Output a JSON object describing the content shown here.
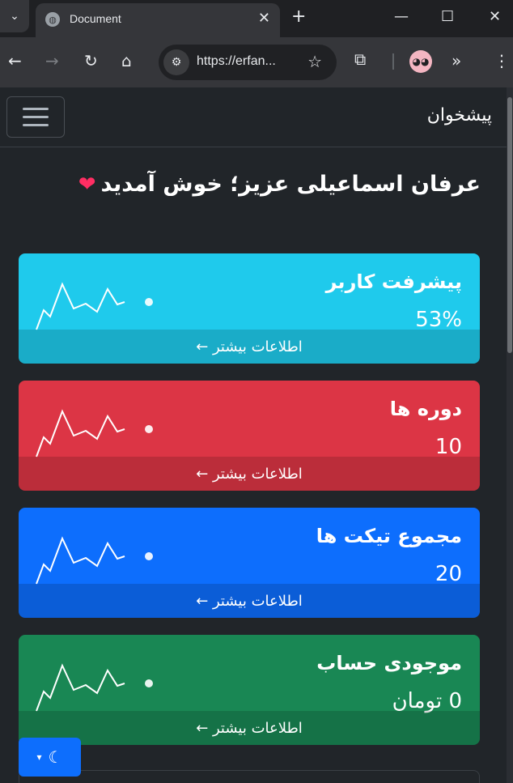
{
  "browser": {
    "tab_title": "Document",
    "url": "https://erfan...",
    "new_tab": "+",
    "close_tab": "✕",
    "minimize": "—",
    "maximize": "☐",
    "close_window": "✕"
  },
  "navbar": {
    "brand": "پیشخوان"
  },
  "welcome": {
    "text": "عرفان اسماعیلی عزیز؛ خوش آمدید",
    "heart": "❤"
  },
  "cards": [
    {
      "label": "پیشرفت کاربر",
      "value": "53%",
      "footer": "اطلاعات بیشتر ←",
      "color": "#1fcaec"
    },
    {
      "label": "دوره ها",
      "value": "10",
      "footer": "اطلاعات بیشتر ←",
      "color": "#dc3545"
    },
    {
      "label": "مجموع تیکت ها",
      "value": "20",
      "footer": "اطلاعات بیشتر ←",
      "color": "#0d6efd"
    },
    {
      "label": "موجودی حساب",
      "value": "0 تومان",
      "footer": "اطلاعات بیشتر ←",
      "color": "#198754"
    }
  ],
  "theme_toggle": {
    "icon": "moon-icon",
    "caret": "▾"
  }
}
